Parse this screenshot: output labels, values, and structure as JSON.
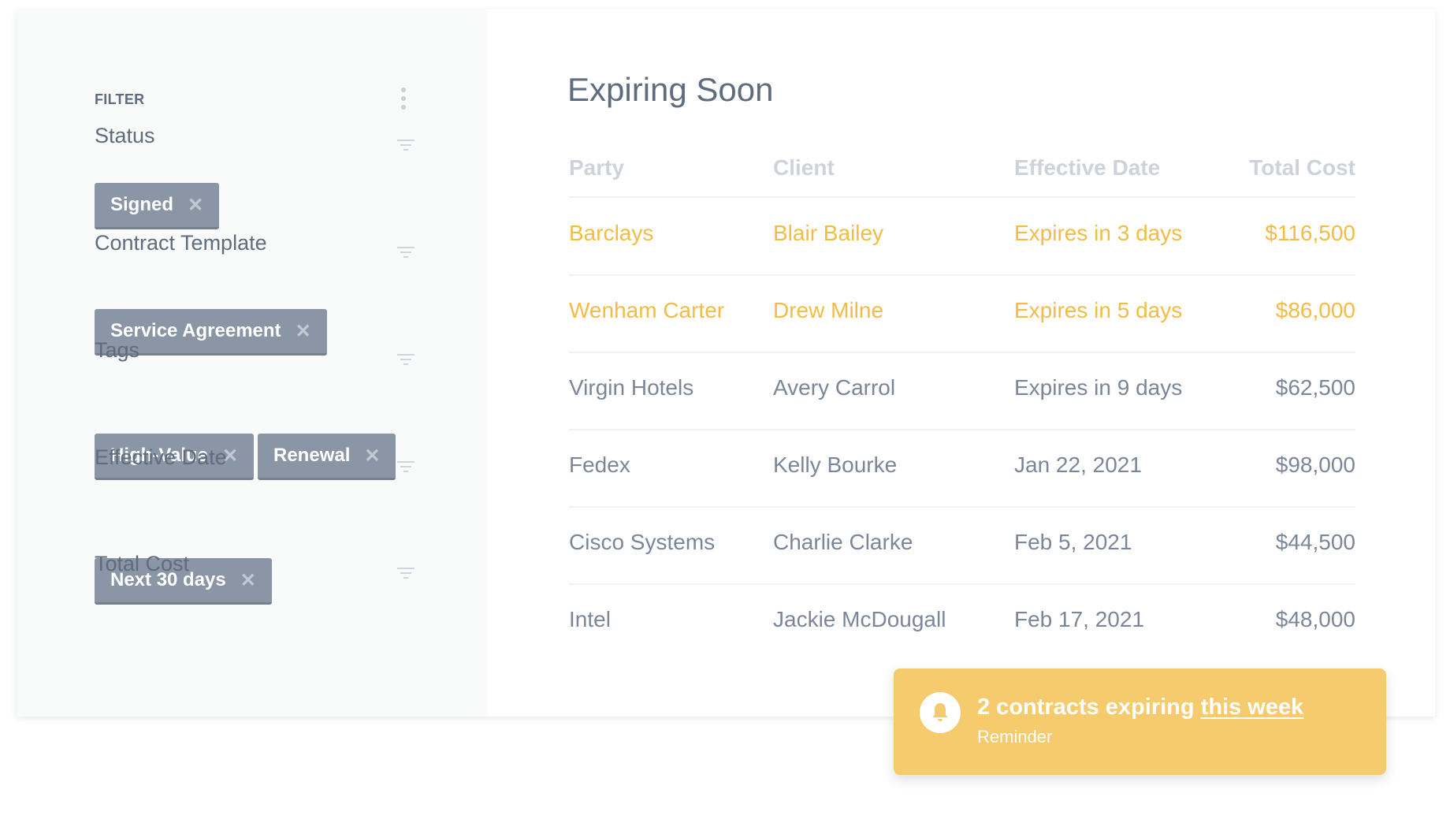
{
  "sidebar": {
    "title": "FILTER",
    "sections": [
      {
        "label": "Status",
        "tags": [
          "Signed"
        ]
      },
      {
        "label": "Contract Template",
        "tags": [
          "Service Agreement"
        ]
      },
      {
        "label": "Tags",
        "tags": [
          "High-Value",
          "Renewal"
        ]
      },
      {
        "label": "Effective Date",
        "tags": [
          "Next 30 days"
        ]
      },
      {
        "label": "Total Cost",
        "tags": []
      }
    ],
    "remove_glyph": "✕"
  },
  "main": {
    "title": "Expiring Soon",
    "columns": [
      "Party",
      "Client",
      "Effective Date",
      "Total Cost"
    ],
    "rows": [
      {
        "party": "Barclays",
        "client": "Blair Bailey",
        "date": "Expires in 3 days",
        "cost": "$116,500",
        "highlight": true
      },
      {
        "party": "Wenham Carter",
        "client": "Drew Milne",
        "date": "Expires in 5 days",
        "cost": "$86,000",
        "highlight": true
      },
      {
        "party": "Virgin Hotels",
        "client": "Avery Carrol",
        "date": "Expires in 9 days",
        "cost": "$62,500",
        "highlight": false
      },
      {
        "party": "Fedex",
        "client": "Kelly Bourke",
        "date": "Jan 22, 2021",
        "cost": "$98,000",
        "highlight": false
      },
      {
        "party": "Cisco Systems",
        "client": "Charlie Clarke",
        "date": "Feb 5, 2021",
        "cost": "$44,500",
        "highlight": false
      },
      {
        "party": "Intel",
        "client": "Jackie McDougall",
        "date": "Feb 17, 2021",
        "cost": "$48,000",
        "highlight": false
      }
    ]
  },
  "toast": {
    "title_prefix": "2 contracts expiring ",
    "title_link": "this week",
    "subtitle": "Reminder",
    "icon": "bell-icon"
  },
  "colors": {
    "warning_text": "#f4bb45",
    "toast_bg": "#f5cb6e",
    "tag_bg": "#8a96a5",
    "text": "#5f6c7e"
  }
}
